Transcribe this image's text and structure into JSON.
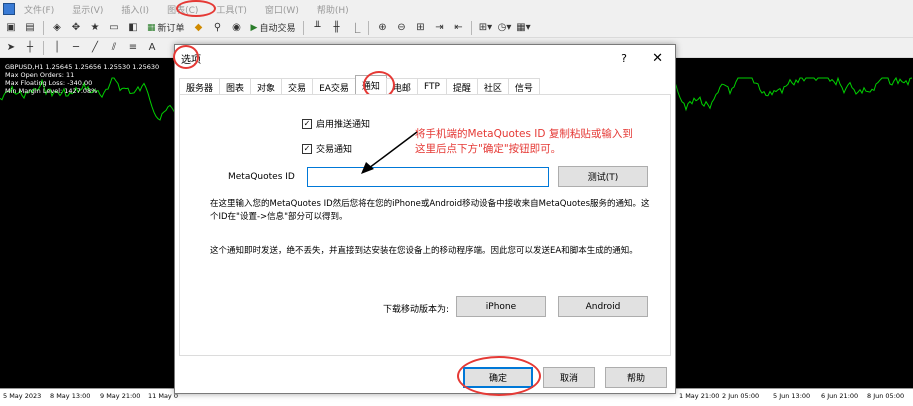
{
  "menu": [
    "文件(F)",
    "显示(V)",
    "插入(I)",
    "图表(C)",
    "工具(T)",
    "窗口(W)",
    "帮助(H)"
  ],
  "toolbar": {
    "new_order": "新订单",
    "auto_trading": "自动交易"
  },
  "chart": {
    "symbol_line": "GBPUSD,H1  1.25645 1.25656 1.25530 1.25630",
    "info": [
      "Max Open Orders: 11",
      "Max Floating Loss: -340.00",
      "Min Margin Level: 1427.08%"
    ],
    "time_labels": [
      "5 May 2023",
      "8 May 13:00",
      "9 May 21:00",
      "11 May 0",
      "1 May 21:00",
      "2 Jun 05:00",
      "5 Jun 13:00",
      "6 Jun 21:00",
      "8 Jun 05:00"
    ],
    "line_color": "#00d000"
  },
  "dialog": {
    "title": "选项",
    "help": "?",
    "close": "✕",
    "tabs": [
      "服务器",
      "图表",
      "对象",
      "交易",
      "EA交易",
      "通知",
      "电邮",
      "FTP",
      "提醒",
      "社区",
      "信号"
    ],
    "active_tab": "通知",
    "enable_push": "启用推送通知",
    "trade_notify": "交易通知",
    "metaquotes_label": "MetaQuotes ID",
    "metaquotes_value": "",
    "test_button": "测试(T)",
    "para1": "在这里输入您的MetaQuotes ID然后您将在您的iPhone或Android移动设备中接收来自MetaQuotes服务的通知。这个ID在\"设置->信息\"部分可以得到。",
    "para2": "这个通知即时发送，绝不丢失，并直接到达安装在您设备上的移动程序端。因此您可以发送EA和脚本生成的通知。",
    "download_label": "下载移动版本为:",
    "iphone": "iPhone",
    "android": "Android",
    "ok": "确定",
    "cancel": "取消",
    "help_btn": "帮助"
  },
  "annotation": {
    "line1": "将手机端的MetaQuotes ID 复制粘贴或输入到",
    "line2": "这里后点下方\"确定\"按钮即可。",
    "color": "#e53935"
  }
}
